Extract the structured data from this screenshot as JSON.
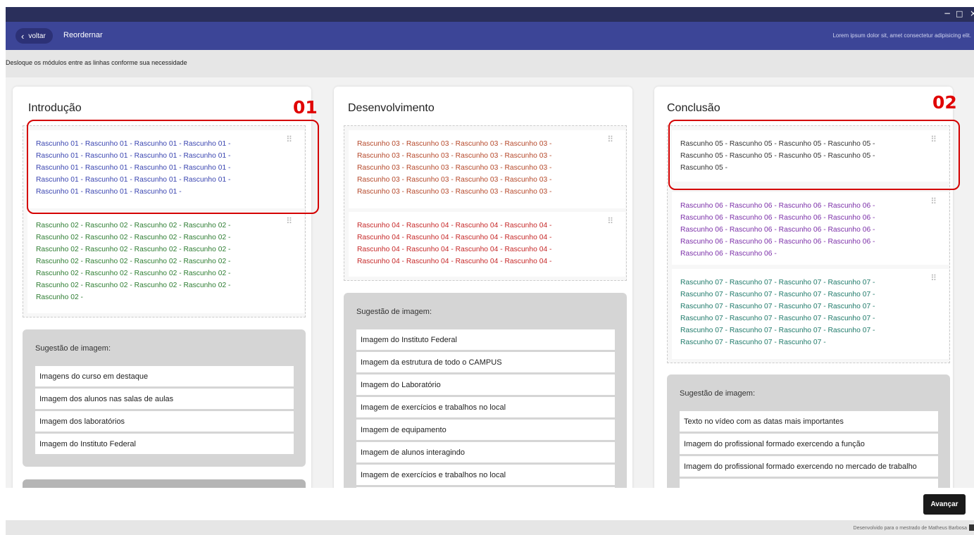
{
  "window": {
    "minimize": "−",
    "maximize": "□",
    "close": "×"
  },
  "header": {
    "back_label": "voltar",
    "title": "Reordernar",
    "subtitle": "Lorem ipsum dolor sit, amet consectetur adipisicing elit."
  },
  "instruction": "Desloque os módulos entre as linhas conforme sua necessidade",
  "columns": [
    {
      "title": "Introdução",
      "marker": "01",
      "cards": [
        {
          "text": "Rascunho 01 - Rascunho 01 - Rascunho 01 - Rascunho 01 - Rascunho 01 - Rascunho 01 - Rascunho 01 - Rascunho 01 - Rascunho 01 - Rascunho 01 - Rascunho 01 - Rascunho 01 - Rascunho 01 - Rascunho 01 - Rascunho 01 - Rascunho 01 - Rascunho 01 - Rascunho 01 - Rascunho 01 -",
          "color": "#3a45b0"
        },
        {
          "text": "Rascunho 02 - Rascunho 02 - Rascunho 02 - Rascunho 02 - Rascunho 02 - Rascunho 02 - Rascunho 02 - Rascunho 02 - Rascunho 02 - Rascunho 02 - Rascunho 02 - Rascunho 02 - Rascunho 02 - Rascunho 02 - Rascunho 02 - Rascunho 02 - Rascunho 02 - Rascunho 02 - Rascunho 02 - Rascunho 02 - Rascunho 02 - Rascunho 02 - Rascunho 02 - Rascunho 02 - Rascunho 02 -",
          "color": "#2e7d32"
        }
      ],
      "suggestion_title": "Sugestão de imagem:",
      "suggestions": [
        "Imagens do curso em destaque",
        "Imagem dos alunos nas salas de aulas",
        "Imagem dos laboratórios",
        "Imagem do Instituto Federal"
      ]
    },
    {
      "title": "Desenvolvimento",
      "cards": [
        {
          "text": "Rascunho 03 - Rascunho 03 - Rascunho 03 - Rascunho 03 - Rascunho 03 - Rascunho 03 - Rascunho 03 - Rascunho 03 - Rascunho 03 - Rascunho 03 - Rascunho 03 - Rascunho 03 - Rascunho 03 - Rascunho 03 - Rascunho 03 - Rascunho 03 - Rascunho 03 - Rascunho 03 - Rascunho 03 - Rascunho 03 -",
          "color": "#b5482a"
        },
        {
          "text": "Rascunho 04 - Rascunho 04 - Rascunho 04 - Rascunho 04 - Rascunho 04 - Rascunho 04 - Rascunho 04 - Rascunho 04 - Rascunho 04 - Rascunho 04 - Rascunho 04 - Rascunho 04 - Rascunho 04 - Rascunho 04 - Rascunho 04 - Rascunho 04 -",
          "color": "#c62828"
        }
      ],
      "suggestion_title": "Sugestão de imagem:",
      "suggestions": [
        "Imagem do Instituto Federal",
        "Imagem da estrutura de todo o CAMPUS",
        "Imagem do Laboratório",
        "Imagem de exercícios e trabalhos no local",
        "Imagem de equipamento",
        "Imagem de alunos interagindo",
        "Imagem de exercícios e trabalhos no local"
      ]
    },
    {
      "title": "Conclusão",
      "marker": "02",
      "cards": [
        {
          "text": "Rascunho 05 - Rascunho 05 - Rascunho 05 - Rascunho 05 - Rascunho 05 - Rascunho 05 - Rascunho 05 - Rascunho 05 - Rascunho 05 -",
          "color": "#333333"
        },
        {
          "text": "Rascunho 06 - Rascunho 06 - Rascunho 06 - Rascunho 06 - Rascunho 06 - Rascunho 06 - Rascunho 06 - Rascunho 06 - Rascunho 06 - Rascunho 06 - Rascunho 06 - Rascunho 06 - Rascunho 06 - Rascunho 06 - Rascunho 06 - Rascunho 06 - Rascunho 06 - Rascunho 06 -",
          "color": "#7b2fa8"
        },
        {
          "text": "Rascunho 07 - Rascunho 07 - Rascunho 07 - Rascunho 07 - Rascunho 07 - Rascunho 07 - Rascunho 07 - Rascunho 07 - Rascunho 07 - Rascunho 07 - Rascunho 07 - Rascunho 07 - Rascunho 07 - Rascunho 07 - Rascunho 07 - Rascunho 07 - Rascunho 07 - Rascunho 07 - Rascunho 07 - Rascunho 07 - Rascunho 07 - Rascunho 07 - Rascunho 07 -",
          "color": "#1f7a6a"
        }
      ],
      "suggestion_title": "Sugestão de imagem:",
      "suggestions": [
        "Texto no vídeo com as datas mais importantes",
        "Imagem do profissional formado exercendo a função",
        "Imagem do profissional formado exercendo no mercado de trabalho",
        ""
      ]
    }
  ],
  "next_label": "Avançar",
  "footer": "Desenvolvido para o mestrado de Matheus Barbosa"
}
